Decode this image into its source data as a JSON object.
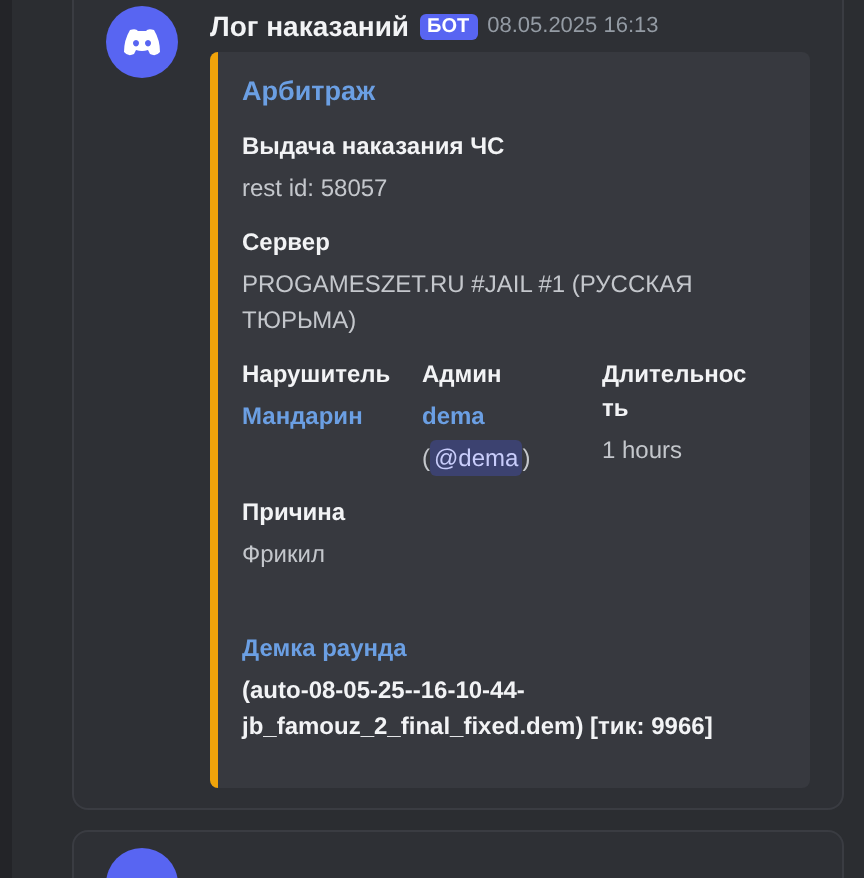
{
  "message": {
    "author": "Лог наказаний",
    "badge": "БОТ",
    "timestamp": "08.05.2025 16:13",
    "embed": {
      "title": "Арбитраж",
      "fields": [
        {
          "kind": "text",
          "inline": false,
          "name": "Выдача наказания ЧС",
          "value": "rest id: 58057"
        },
        {
          "kind": "text",
          "inline": false,
          "name": "Сервер",
          "value": "PROGAMESZET.RU #JAIL #1 (РУССКАЯ ТЮРЬМА)"
        },
        {
          "kind": "link_value",
          "inline": true,
          "name": "Нарушитель",
          "value": "Мандарин"
        },
        {
          "kind": "user",
          "inline": true,
          "name": "Админ",
          "value": "dema",
          "mention_open": "(",
          "mention": "@dema",
          "mention_close": ")"
        },
        {
          "kind": "text",
          "inline": true,
          "name": "Длительность",
          "value": "1 hours"
        },
        {
          "kind": "text",
          "inline": false,
          "name": "Причина",
          "value": "Фрикил"
        },
        {
          "kind": "link_name",
          "inline": false,
          "name": "Демка раунда",
          "value": "(auto-08-05-25--16-10-44-jb_famouz_2_final_fixed.dem) [тик: 9966]"
        }
      ]
    }
  }
}
